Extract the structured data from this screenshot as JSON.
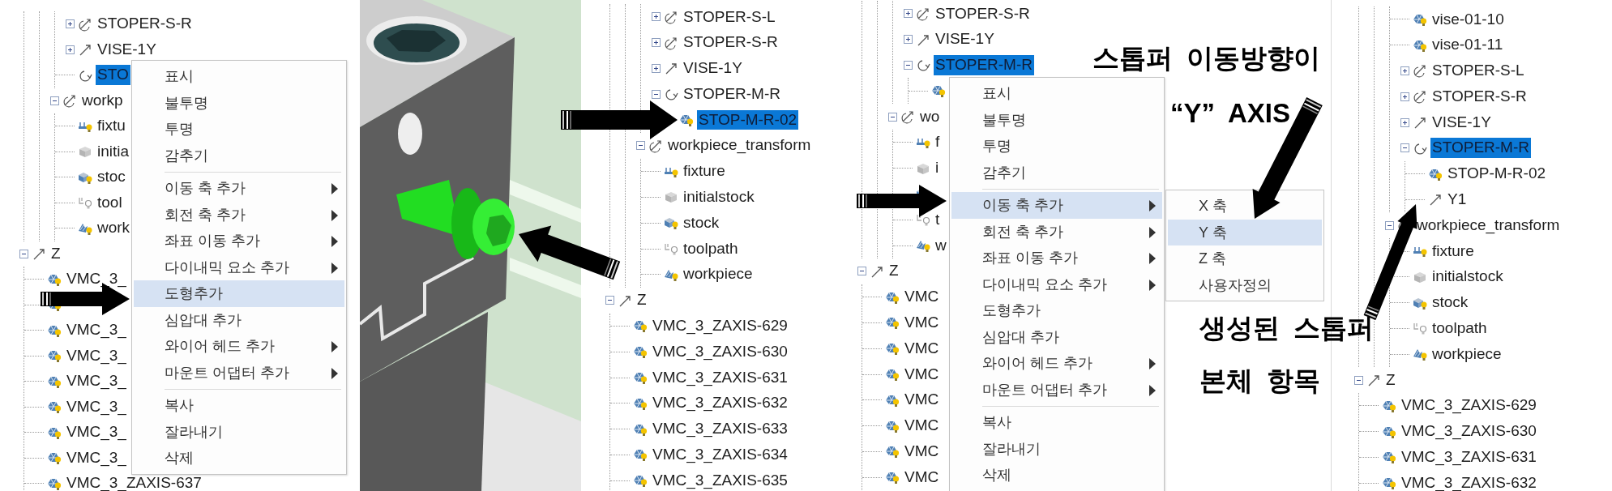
{
  "panels": [
    {
      "kind": "tree",
      "tree": [
        {
          "children": [
            {
              "children": [
                {
                  "children": [
                    {
                      "label": "STOPER-S-R",
                      "kind": "transform",
                      "expanded": false,
                      "selected": false
                    },
                    {
                      "label": "VISE-1Y",
                      "kind": "axis",
                      "expanded": false,
                      "selected": false
                    },
                    {
                      "label": "STO",
                      "kind": "rotation",
                      "selected": true
                    }
                  ]
                },
                {
                  "label": "workp",
                  "kind": "transform",
                  "expanded": true,
                  "selected": false,
                  "children": [
                    {
                      "label": "fixtu",
                      "kind": "fixture",
                      "selected": false
                    },
                    {
                      "label": "initia",
                      "kind": "block",
                      "selected": false
                    },
                    {
                      "label": "stoc",
                      "kind": "stock",
                      "selected": false
                    },
                    {
                      "label": "tool",
                      "kind": "toolpath",
                      "selected": false
                    },
                    {
                      "label": "work",
                      "kind": "workpiece",
                      "selected": false
                    }
                  ]
                }
              ]
            }
          ]
        },
        {
          "label": "Z",
          "kind": "axis",
          "expanded": true,
          "selected": false,
          "children": [
            {
              "label": "VMC_3_",
              "kind": "part",
              "selected": false
            },
            {
              "kind": "part"
            },
            {
              "label": "VMC_3_",
              "kind": "part",
              "selected": false
            },
            {
              "label": "VMC_3_",
              "kind": "part",
              "selected": false
            },
            {
              "label": "VMC_3_",
              "kind": "part",
              "selected": false
            },
            {
              "label": "VMC_3_",
              "kind": "part",
              "selected": false
            },
            {
              "label": "VMC_3_",
              "kind": "part",
              "selected": false
            },
            {
              "label": "VMC_3_",
              "kind": "part",
              "selected": false
            },
            {
              "label": "VMC_3_ZAXIS-637",
              "kind": "part",
              "selected": false
            }
          ]
        }
      ],
      "menu": {
        "groups": [
          [
            {
              "label": "표시",
              "selected": false,
              "has_submenu": false
            },
            {
              "label": "불투명",
              "selected": false,
              "has_submenu": false
            },
            {
              "label": "투명",
              "selected": false,
              "has_submenu": false
            },
            {
              "label": "감추기",
              "selected": false,
              "has_submenu": false
            }
          ],
          [
            {
              "label": "이동 축 추가",
              "selected": false,
              "has_submenu": true
            },
            {
              "label": "회전 축 추가",
              "selected": false,
              "has_submenu": true
            },
            {
              "label": "좌표 이동 추가",
              "selected": false,
              "has_submenu": true
            },
            {
              "label": "다이내믹 요소 추가",
              "selected": false,
              "has_submenu": true
            },
            {
              "label": "도형추가",
              "selected": true,
              "has_submenu": false
            },
            {
              "label": "심압대 추가",
              "selected": false,
              "has_submenu": false
            },
            {
              "label": "와이어 헤드 추가",
              "selected": false,
              "has_submenu": true
            },
            {
              "label": "마운트 어댑터 추가",
              "selected": false,
              "has_submenu": true
            }
          ],
          [
            {
              "label": "복사",
              "selected": false,
              "has_submenu": false
            },
            {
              "label": "잘라내기",
              "selected": false,
              "has_submenu": false
            },
            {
              "label": "삭제",
              "selected": false,
              "has_submenu": false
            }
          ]
        ]
      }
    },
    {
      "kind": "picture"
    },
    {
      "kind": "tree",
      "tree": [
        {
          "children": [
            {
              "children": [
                {
                  "children": [
                    {
                      "label": "STOPER-S-L",
                      "kind": "transform",
                      "expanded": false,
                      "selected": false
                    },
                    {
                      "label": "STOPER-S-R",
                      "kind": "transform",
                      "expanded": false,
                      "selected": false
                    },
                    {
                      "label": "VISE-1Y",
                      "kind": "axis",
                      "expanded": false,
                      "selected": false
                    },
                    {
                      "label": "STOPER-M-R",
                      "kind": "rotation",
                      "expanded": true,
                      "selected": false,
                      "children": [
                        {
                          "label": "STOP-M-R-02",
                          "kind": "part",
                          "selected": true
                        }
                      ]
                    }
                  ]
                },
                {
                  "label": "workpiece_transform",
                  "kind": "transform",
                  "expanded": true,
                  "selected": false,
                  "children": [
                    {
                      "label": "fixture",
                      "kind": "fixture",
                      "selected": false
                    },
                    {
                      "label": "initialstock",
                      "kind": "block",
                      "selected": false
                    },
                    {
                      "label": "stock",
                      "kind": "stock",
                      "selected": false
                    },
                    {
                      "label": "toolpath",
                      "kind": "toolpath",
                      "selected": false
                    },
                    {
                      "label": "workpiece",
                      "kind": "workpiece",
                      "selected": false
                    }
                  ]
                }
              ]
            }
          ]
        },
        {
          "label": "Z",
          "kind": "axis",
          "expanded": true,
          "selected": false,
          "children": [
            {
              "label": "VMC_3_ZAXIS-629",
              "kind": "part",
              "selected": false
            },
            {
              "label": "VMC_3_ZAXIS-630",
              "kind": "part",
              "selected": false
            },
            {
              "label": "VMC_3_ZAXIS-631",
              "kind": "part",
              "selected": false
            },
            {
              "label": "VMC_3_ZAXIS-632",
              "kind": "part",
              "selected": false
            },
            {
              "label": "VMC_3_ZAXIS-633",
              "kind": "part",
              "selected": false
            },
            {
              "label": "VMC_3_ZAXIS-634",
              "kind": "part",
              "selected": false
            },
            {
              "label": "VMC_3_ZAXIS-635",
              "kind": "part",
              "selected": false
            }
          ]
        }
      ]
    },
    {
      "kind": "tree",
      "tree": [
        {
          "children": [
            {
              "children": [
                {
                  "children": [
                    {
                      "label": "STOPER-S-R",
                      "kind": "transform",
                      "expanded": false,
                      "selected": false
                    },
                    {
                      "label": "VISE-1Y",
                      "kind": "axis",
                      "expanded": false,
                      "selected": false
                    },
                    {
                      "label": "STOPER-M-R",
                      "kind": "rotation",
                      "expanded": true,
                      "selected": true,
                      "children": [
                        {
                          "kind": "part"
                        }
                      ]
                    }
                  ]
                },
                {
                  "label": "wo",
                  "kind": "transform",
                  "expanded": true,
                  "selected": false,
                  "children": [
                    {
                      "label": "f",
                      "kind": "fixture",
                      "selected": false
                    },
                    {
                      "label": "i",
                      "kind": "block",
                      "selected": false
                    },
                    {
                      "kind": "stock"
                    },
                    {
                      "label": "t",
                      "kind": "toolpath",
                      "selected": false
                    },
                    {
                      "label": "w",
                      "kind": "workpiece",
                      "selected": false
                    }
                  ]
                }
              ]
            }
          ]
        },
        {
          "label": "Z",
          "kind": "axis",
          "expanded": true,
          "selected": false,
          "children": [
            {
              "label": "VMC",
              "kind": "part",
              "selected": false
            },
            {
              "label": "VMC",
              "kind": "part",
              "selected": false
            },
            {
              "label": "VMC",
              "kind": "part",
              "selected": false
            },
            {
              "label": "VMC",
              "kind": "part",
              "selected": false
            },
            {
              "label": "VMC",
              "kind": "part",
              "selected": false
            },
            {
              "label": "VMC",
              "kind": "part",
              "selected": false
            },
            {
              "label": "VMC",
              "kind": "part",
              "selected": false
            },
            {
              "label": "VMC",
              "kind": "part",
              "selected": false
            }
          ]
        }
      ],
      "menu": {
        "groups": [
          [
            {
              "label": "표시",
              "selected": false,
              "has_submenu": false
            },
            {
              "label": "불투명",
              "selected": false,
              "has_submenu": false
            },
            {
              "label": "투명",
              "selected": false,
              "has_submenu": false
            },
            {
              "label": "감추기",
              "selected": false,
              "has_submenu": false
            }
          ],
          [
            {
              "label": "이동 축 추가",
              "selected": true,
              "has_submenu": true
            },
            {
              "label": "회전 축 추가",
              "selected": false,
              "has_submenu": true
            },
            {
              "label": "좌표 이동 추가",
              "selected": false,
              "has_submenu": true
            },
            {
              "label": "다이내믹 요소 추가",
              "selected": false,
              "has_submenu": true
            },
            {
              "label": "도형추가",
              "selected": false,
              "has_submenu": false
            },
            {
              "label": "심압대 추가",
              "selected": false,
              "has_submenu": false
            },
            {
              "label": "와이어 헤드 추가",
              "selected": false,
              "has_submenu": true
            },
            {
              "label": "마운트 어댑터 추가",
              "selected": false,
              "has_submenu": true
            }
          ],
          [
            {
              "label": "복사",
              "selected": false,
              "has_submenu": false
            },
            {
              "label": "잘라내기",
              "selected": false,
              "has_submenu": false
            },
            {
              "label": "삭제",
              "selected": false,
              "has_submenu": false
            }
          ]
        ],
        "submenu": {
          "items": [
            {
              "label": "X 축",
              "selected": false
            },
            {
              "label": "Y 축",
              "selected": true
            },
            {
              "label": "Z 축",
              "selected": false
            },
            {
              "label": "사용자정의",
              "selected": false
            }
          ]
        }
      }
    },
    {
      "kind": "tree",
      "tree": [
        {
          "children": [
            {
              "children": [
                {
                  "children": [
                    {
                      "label": "vise-01-10",
                      "kind": "part",
                      "selected": false
                    },
                    {
                      "label": "vise-01-11",
                      "kind": "part",
                      "selected": false
                    },
                    {
                      "label": "STOPER-S-L",
                      "kind": "transform",
                      "expanded": false,
                      "selected": false
                    },
                    {
                      "label": "STOPER-S-R",
                      "kind": "transform",
                      "expanded": false,
                      "selected": false
                    },
                    {
                      "label": "VISE-1Y",
                      "kind": "axis",
                      "expanded": false,
                      "selected": false
                    },
                    {
                      "label": "STOPER-M-R",
                      "kind": "rotation",
                      "expanded": true,
                      "selected": true,
                      "children": [
                        {
                          "label": "STOP-M-R-02",
                          "kind": "part",
                          "selected": false
                        },
                        {
                          "label": "Y1",
                          "kind": "axis",
                          "selected": false
                        }
                      ]
                    }
                  ]
                },
                {
                  "label": "workpiece_transform",
                  "kind": "transform",
                  "expanded": true,
                  "selected": false,
                  "children": [
                    {
                      "label": "fixture",
                      "kind": "fixture",
                      "selected": false
                    },
                    {
                      "label": "initialstock",
                      "kind": "block",
                      "selected": false
                    },
                    {
                      "label": "stock",
                      "kind": "stock",
                      "selected": false
                    },
                    {
                      "label": "toolpath",
                      "kind": "toolpath",
                      "selected": false
                    },
                    {
                      "label": "workpiece",
                      "kind": "workpiece",
                      "selected": false
                    }
                  ]
                }
              ]
            }
          ]
        },
        {
          "label": "Z",
          "kind": "axis",
          "expanded": true,
          "selected": false,
          "children": [
            {
              "label": "VMC_3_ZAXIS-629",
              "kind": "part",
              "selected": false
            },
            {
              "label": "VMC_3_ZAXIS-630",
              "kind": "part",
              "selected": false
            },
            {
              "label": "VMC_3_ZAXIS-631",
              "kind": "part",
              "selected": false
            },
            {
              "label": "VMC_3_ZAXIS-632",
              "kind": "part",
              "selected": false
            }
          ]
        }
      ]
    }
  ],
  "annotations": [
    {
      "lines": [
        "스톱퍼 이동방향이",
        "“Y” AXIS"
      ]
    },
    {
      "lines": [
        "생성된 스톱퍼",
        "본체 항목"
      ]
    }
  ]
}
